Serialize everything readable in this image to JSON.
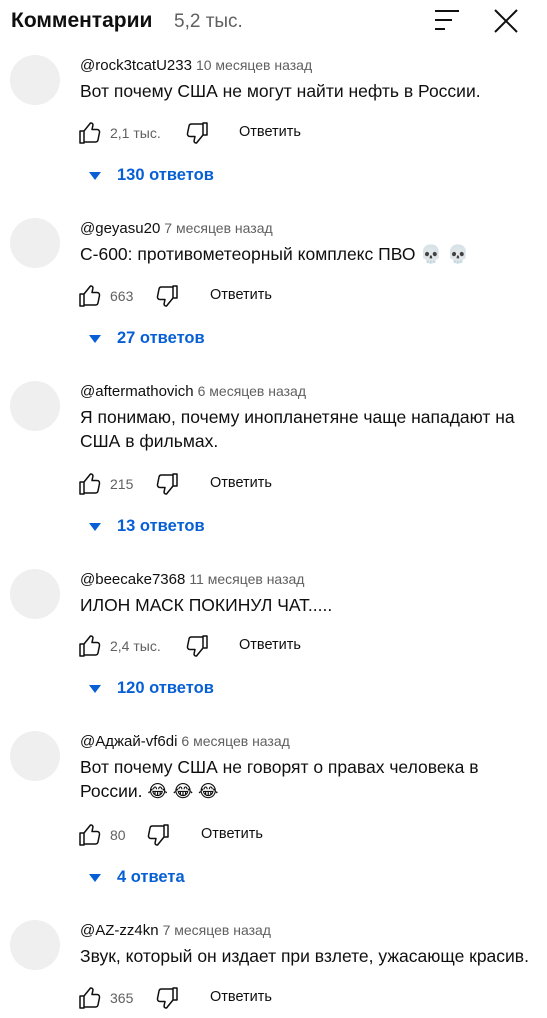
{
  "header": {
    "title": "Комментарии",
    "count": "5,2 тыс."
  },
  "comments": [
    {
      "author": "@rock3tcatU233",
      "time": "10 месяцев назад",
      "text": "Вот почему США не могут найти нефть в России.",
      "likes": "2,1 тыс.",
      "reply_label": "Ответить",
      "replies": "130 ответов"
    },
    {
      "author": "@geyasu20",
      "time": "7 месяцев назад",
      "text": "С-600: противометеорный комплекс ПВО 💀 💀",
      "likes": "663",
      "reply_label": "Ответить",
      "replies": "27 ответов"
    },
    {
      "author": "@aftermathovich",
      "time": "6 месяцев назад",
      "text": "Я понимаю, почему инопланетяне чаще нападают на США в фильмах.",
      "likes": "215",
      "reply_label": "Ответить",
      "replies": "13 ответов"
    },
    {
      "author": "@beecake7368",
      "time": "11 месяцев назад",
      "text": "ИЛОН МАСК ПОКИНУЛ ЧАТ.....",
      "likes": "2,4 тыс.",
      "reply_label": "Ответить",
      "replies": "120 ответов"
    },
    {
      "author": "@Аджай-vf6di",
      "time": "6 месяцев назад",
      "text": "Вот почему США не говорят о правах человека в России. 😂 😂 😂",
      "likes": "80",
      "reply_label": "Ответить",
      "replies": "4 ответа"
    },
    {
      "author": "@AZ-zz4kn",
      "time": "7 месяцев назад",
      "text": "Звук, который он издает при взлете, ужасающе красив.",
      "likes": "365",
      "reply_label": "Ответить"
    }
  ],
  "colors": {
    "link": "#065fd4",
    "secondary_text": "#606060",
    "avatar": "#efefef"
  },
  "icons": [
    "sort-icon",
    "close-icon",
    "thumb-up-icon",
    "thumb-down-icon",
    "caret-down-icon"
  ]
}
